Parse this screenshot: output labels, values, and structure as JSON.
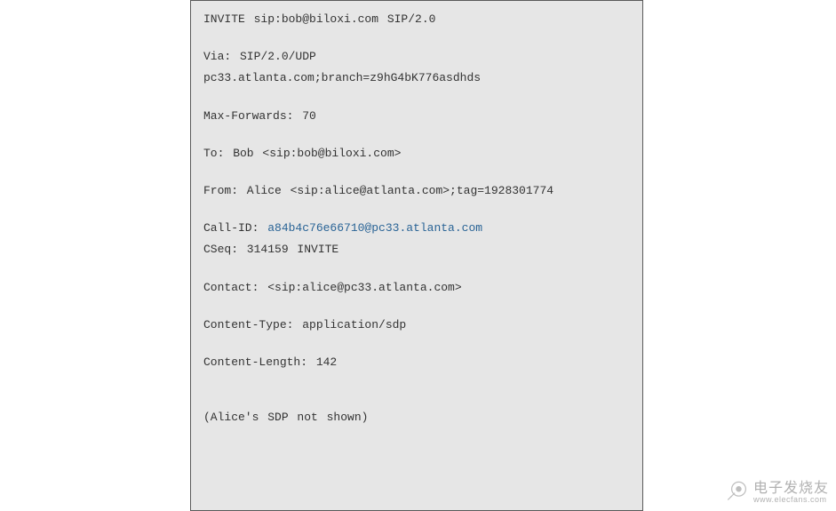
{
  "sip": {
    "request": "INVITE sip:bob@biloxi.com SIP/2.0",
    "via_label": "Via: SIP/2.0/UDP",
    "via_value": "pc33.atlanta.com;branch=z9hG4bK776asdhds",
    "max_forwards": "Max-Forwards: 70",
    "to": "To: Bob <sip:bob@biloxi.com>",
    "from": "From: Alice <sip:alice@atlanta.com>;tag=1928301774",
    "call_id_label": "Call-ID: ",
    "call_id_value": "a84b4c76e66710@pc33.atlanta.com",
    "cseq": "CSeq: 314159 INVITE",
    "contact": "Contact: <sip:alice@pc33.atlanta.com>",
    "content_type": "Content-Type: application/sdp",
    "content_length": "Content-Length: 142",
    "note": "(Alice's SDP not shown)"
  },
  "watermark": {
    "text_cn": "电子发烧友",
    "url": "www.elecfans.com"
  }
}
